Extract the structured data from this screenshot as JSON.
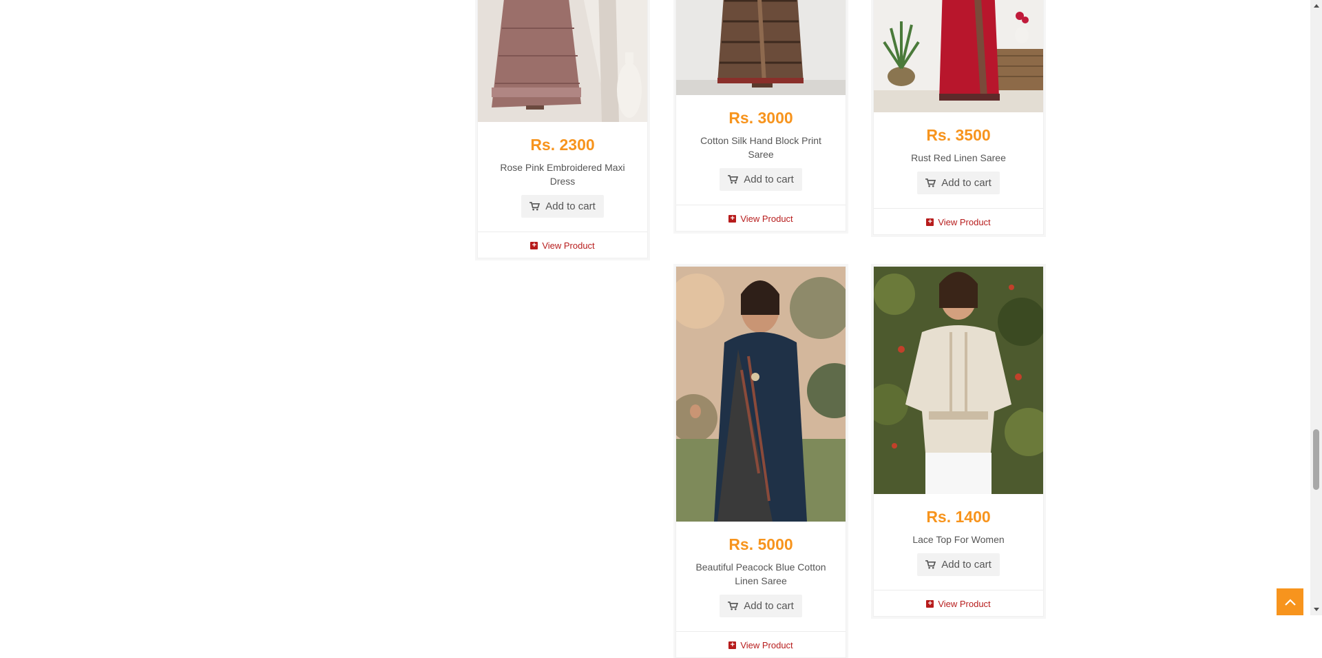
{
  "products": [
    {
      "price": "Rs. 2300",
      "title": "Rose Pink Embroidered Maxi Dress",
      "cart_label": "Add to cart",
      "view_label": "View Product"
    },
    {
      "price": "Rs. 3000",
      "title": "Cotton Silk Hand Block Print Saree",
      "cart_label": "Add to cart",
      "view_label": "View Product"
    },
    {
      "price": "Rs. 3500",
      "title": "Rust Red Linen Saree",
      "cart_label": "Add to cart",
      "view_label": "View Product"
    },
    {
      "price": "Rs. 5000",
      "title": "Beautiful Peacock Blue Cotton Linen Saree",
      "cart_label": "Add to cart",
      "view_label": "View Product"
    },
    {
      "price": "Rs. 1400",
      "title": "Lace Top For Women",
      "cart_label": "Add to cart",
      "view_label": "View Product"
    }
  ],
  "icons": {
    "cart": "shopping-cart-icon",
    "view": "plus-square-icon",
    "scroll_top": "chevron-up-icon",
    "scroll_up": "scroll-up-arrow-icon",
    "scroll_down": "scroll-down-arrow-icon"
  },
  "colors": {
    "price": "#f7941d",
    "view_link": "#b71c1c",
    "scroll_top_bg": "#f7941d",
    "cart_button_bg": "#f2f2f2"
  }
}
